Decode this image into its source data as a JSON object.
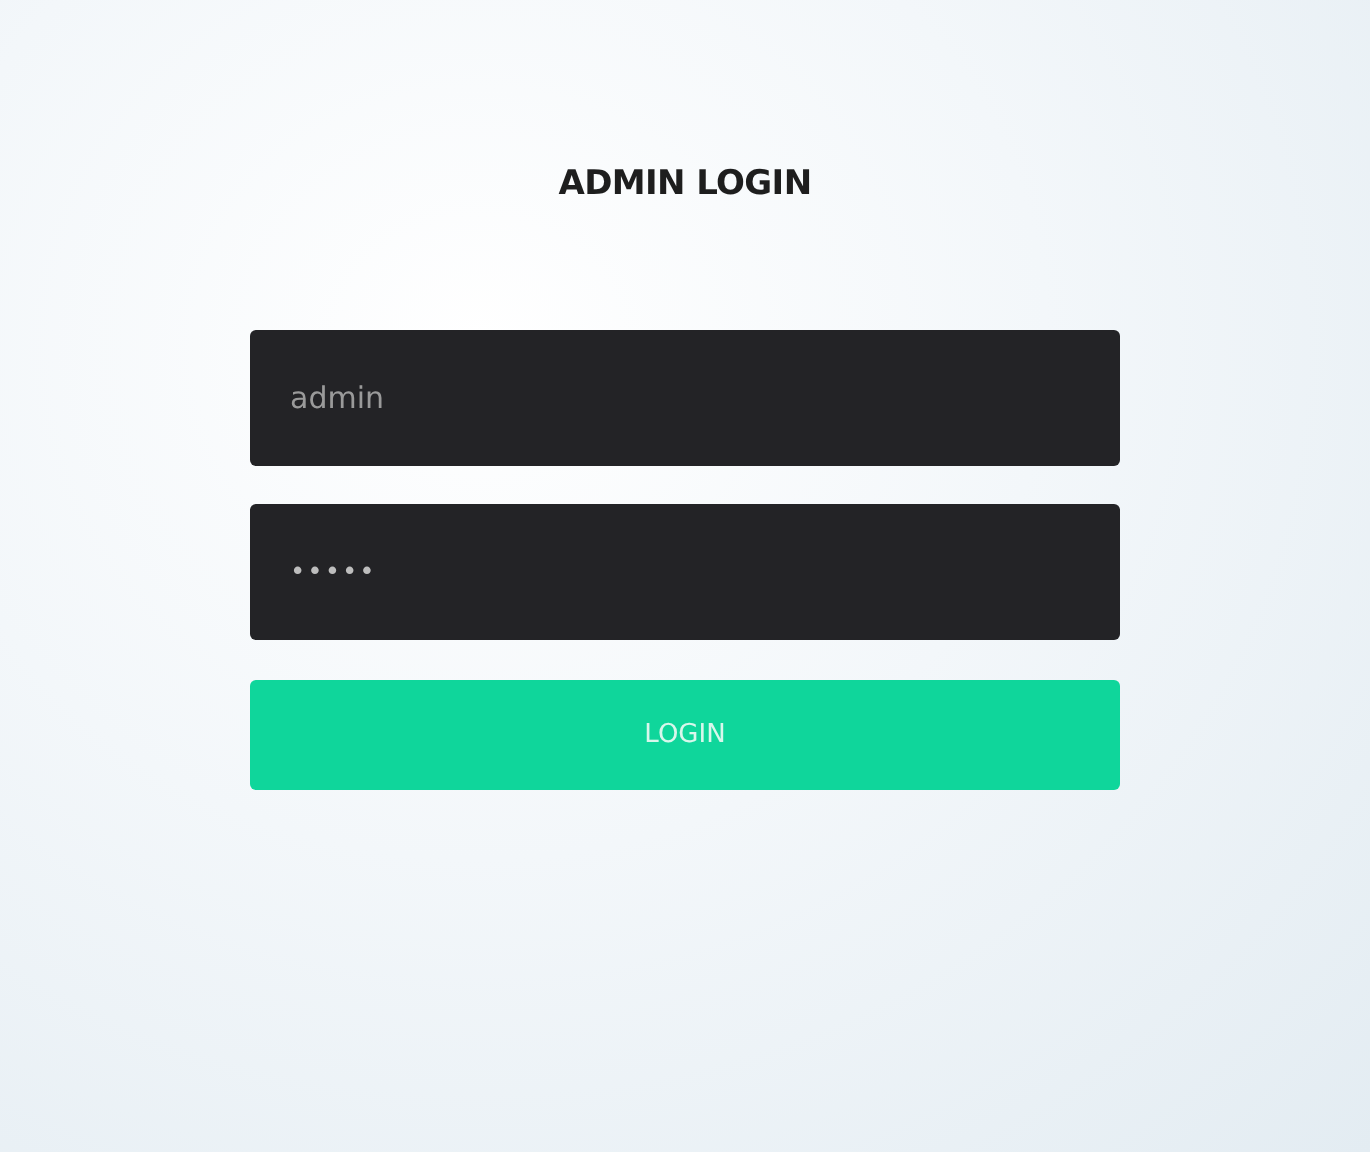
{
  "title": "ADMIN LOGIN",
  "fields": [
    {
      "kind": "username",
      "value": "admin"
    },
    {
      "kind": "password",
      "value": "•••••"
    }
  ],
  "button": {
    "label": "LOGIN"
  }
}
